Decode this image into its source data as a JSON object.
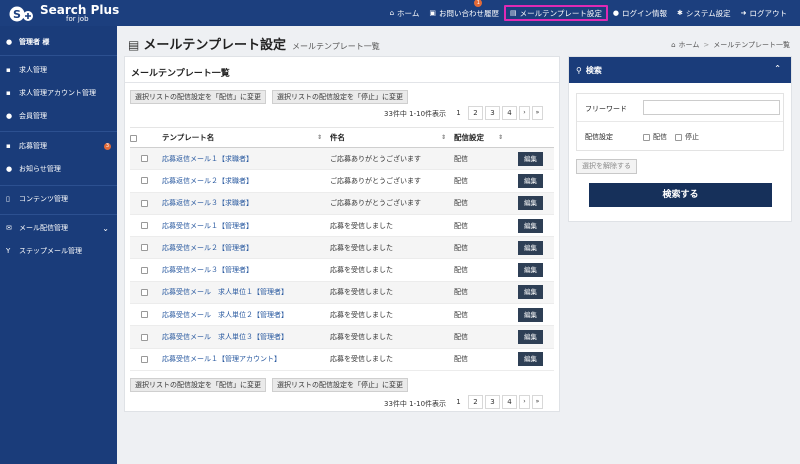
{
  "header": {
    "logo_text": "Search Plus",
    "logo_sub": "for job",
    "nav": [
      {
        "icon": "home-icon",
        "glyph": "⌂",
        "label": "ホーム"
      },
      {
        "icon": "inquiry-icon",
        "glyph": "▣",
        "label": "お問い合わせ履歴",
        "badge": "1"
      },
      {
        "icon": "mail-template-icon",
        "glyph": "▤",
        "label": "メールテンプレート設定",
        "active": true
      },
      {
        "icon": "user-key-icon",
        "glyph": "●",
        "label": "ログイン情報"
      },
      {
        "icon": "gear-icon",
        "glyph": "✱",
        "label": "システム設定"
      },
      {
        "icon": "logout-icon",
        "glyph": "➜",
        "label": "ログアウト"
      }
    ]
  },
  "sidebar": {
    "user": "管理者 様",
    "items": [
      {
        "label": "求人管理"
      },
      {
        "label": "求人管理アカウント管理"
      },
      {
        "label": "会員管理"
      },
      {
        "label": "応募管理",
        "badge": "3"
      },
      {
        "label": "お知らせ管理"
      },
      {
        "label": "コンテンツ管理"
      },
      {
        "label": "メール配信管理"
      },
      {
        "label": "ステップメール管理"
      }
    ]
  },
  "page": {
    "title": "メールテンプレート設定",
    "subtitle": "メールテンプレート一覧",
    "breadcrumb_home": "ホーム",
    "breadcrumb_sep": ">",
    "breadcrumb_current": "メールテンプレート一覧"
  },
  "list": {
    "title": "メールテンプレート一覧",
    "btn_enable": "選択リストの配信設定を「配信」に変更",
    "btn_disable": "選択リストの配信設定を「停止」に変更",
    "count_text": "33件中 1-10件表示",
    "pages": [
      "1",
      "2",
      "3",
      "4"
    ],
    "next": "›",
    "last": "»",
    "columns": {
      "name": "テンプレート名",
      "subject": "件名",
      "status": "配信設定"
    },
    "edit_label": "編集",
    "rows": [
      {
        "name": "応募返信メール１【求職者】",
        "subject": "ご応募ありがとうございます",
        "status": "配信"
      },
      {
        "name": "応募返信メール２【求職者】",
        "subject": "ご応募ありがとうございます",
        "status": "配信"
      },
      {
        "name": "応募返信メール３【求職者】",
        "subject": "ご応募ありがとうございます",
        "status": "配信"
      },
      {
        "name": "応募受信メール１【管理者】",
        "subject": "応募を受信しました",
        "status": "配信"
      },
      {
        "name": "応募受信メール２【管理者】",
        "subject": "応募を受信しました",
        "status": "配信"
      },
      {
        "name": "応募受信メール３【管理者】",
        "subject": "応募を受信しました",
        "status": "配信"
      },
      {
        "name": "応募受信メール　求人単位１【管理者】",
        "subject": "応募を受信しました",
        "status": "配信"
      },
      {
        "name": "応募受信メール　求人単位２【管理者】",
        "subject": "応募を受信しました",
        "status": "配信"
      },
      {
        "name": "応募受信メール　求人単位３【管理者】",
        "subject": "応募を受信しました",
        "status": "配信"
      },
      {
        "name": "応募受信メール１【管理アカウント】",
        "subject": "応募を受信しました",
        "status": "配信"
      }
    ]
  },
  "search": {
    "title": "検索",
    "freeword_label": "フリーワード",
    "freeword_value": "",
    "status_label": "配信設定",
    "opt_on": "配信",
    "opt_off": "停止",
    "clear_label": "選択を解除する",
    "submit_label": "検索する"
  }
}
